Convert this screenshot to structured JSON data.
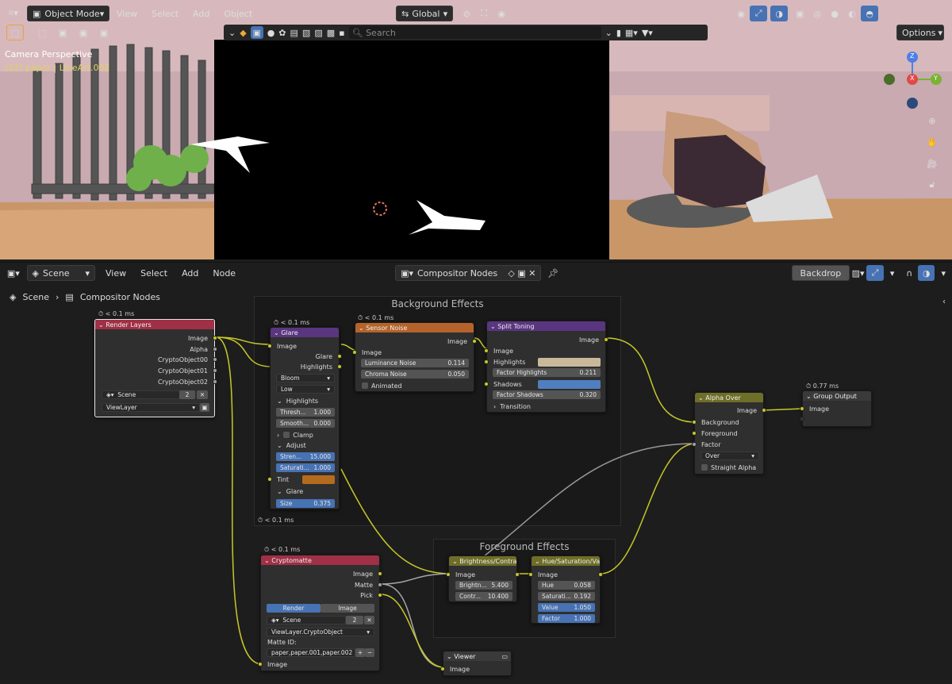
{
  "viewport": {
    "mode": "Object Mode",
    "menu": [
      "View",
      "Select",
      "Add",
      "Object"
    ],
    "orientation": "Global",
    "search_placeholder": "Search",
    "options_label": "Options",
    "camera_label": "Camera Perspective",
    "object_label": "(32) paper | LineArt.002",
    "axis_labels": {
      "x": "X",
      "y": "Y",
      "z": "Z"
    }
  },
  "editor": {
    "scene": "Scene",
    "menu": [
      "View",
      "Select",
      "Add",
      "Node"
    ],
    "tree_name": "Compositor Nodes",
    "backdrop_label": "Backdrop",
    "breadcrumb": [
      "Scene",
      "Compositor Nodes"
    ]
  },
  "frames": {
    "background": "Background Effects",
    "foreground": "Foreground Effects"
  },
  "nodes": {
    "render_layers": {
      "timer": "< 0.1 ms",
      "title": "Render Layers",
      "outputs": [
        "Image",
        "Alpha",
        "CryptoObject00",
        "CryptoObject01",
        "CryptoObject02"
      ],
      "scene": "Scene",
      "scene_users": "2",
      "view_layer": "ViewLayer"
    },
    "glare": {
      "timer": "< 0.1 ms",
      "title": "Glare",
      "outputs": [
        "Glare",
        "Highlights"
      ],
      "input": "Image",
      "type": "Bloom",
      "quality": "Low",
      "section_highlights": "Highlights",
      "threshold_label": "Thresh...",
      "threshold": "1.000",
      "smooth_label": "Smooth...",
      "smooth": "0.000",
      "clamp": "Clamp",
      "section_adjust": "Adjust",
      "strength_label": "Stren...",
      "strength": "15.000",
      "saturation_label": "Saturati...",
      "saturation": "1.000",
      "tint": "Tint",
      "section_glare": "Glare",
      "size_label": "Size",
      "size": "0.375",
      "footer_timer": "< 0.1 ms"
    },
    "sensor_noise": {
      "timer": "< 0.1 ms",
      "title": "Sensor Noise",
      "output": "Image",
      "input": "Image",
      "lum_label": "Luminance Noise",
      "lum": "0.114",
      "chroma_label": "Chroma Noise",
      "chroma": "0.050",
      "animated": "Animated"
    },
    "split_toning": {
      "title": "Split Toning",
      "output": "Image",
      "inputs": [
        "Image",
        "Highlights"
      ],
      "fh_label": "Factor Highlights",
      "fh": "0.211",
      "shadows": "Shadows",
      "fs_label": "Factor Shadows",
      "fs": "0.320",
      "transition": "Transition",
      "highlight_color": "#c9b89a",
      "shadow_color": "#4f7fc0"
    },
    "alpha_over": {
      "title": "Alpha Over",
      "output": "Image",
      "inputs": [
        "Background",
        "Foreground",
        "Factor"
      ],
      "blend": "Over",
      "straight": "Straight Alpha"
    },
    "group_output": {
      "timer": "0.77 ms",
      "title": "Group Output",
      "input": "Image"
    },
    "cryptomatte": {
      "timer": "< 0.1 ms",
      "title": "Cryptomatte",
      "outputs": [
        "Image",
        "Matte",
        "Pick"
      ],
      "tab_render": "Render",
      "tab_image": "Image",
      "scene": "Scene",
      "scene_users": "2",
      "layer": "ViewLayer.CryptoObject",
      "matte_id_label": "Matte ID:",
      "matte_id": "paper,paper.001,paper.002",
      "input": "Image"
    },
    "brightness": {
      "title": "Brightness/Contrast",
      "io": "Image",
      "bright_label": "Brightn...",
      "bright": "5.400",
      "contrast_label": "Contr...",
      "contrast": "10.400"
    },
    "hue_sat": {
      "title": "Hue/Saturation/Va...",
      "io": "Image",
      "hue_label": "Hue",
      "hue": "0.058",
      "sat_label": "Saturati...",
      "sat": "0.192",
      "val_label": "Value",
      "val": "1.050",
      "fac_label": "Factor",
      "fac": "1.000"
    },
    "viewer": {
      "title": "Viewer",
      "input": "Image"
    }
  },
  "colors": {
    "accent": "#4772b3",
    "socket_color": "#c7c729",
    "header_input": "#a03045",
    "header_filter": "#5a3580",
    "header_color": "#6e6e28",
    "header_distort": "#b5632a",
    "header_output": "#3c3c3c",
    "tint": "#b56b1e"
  }
}
